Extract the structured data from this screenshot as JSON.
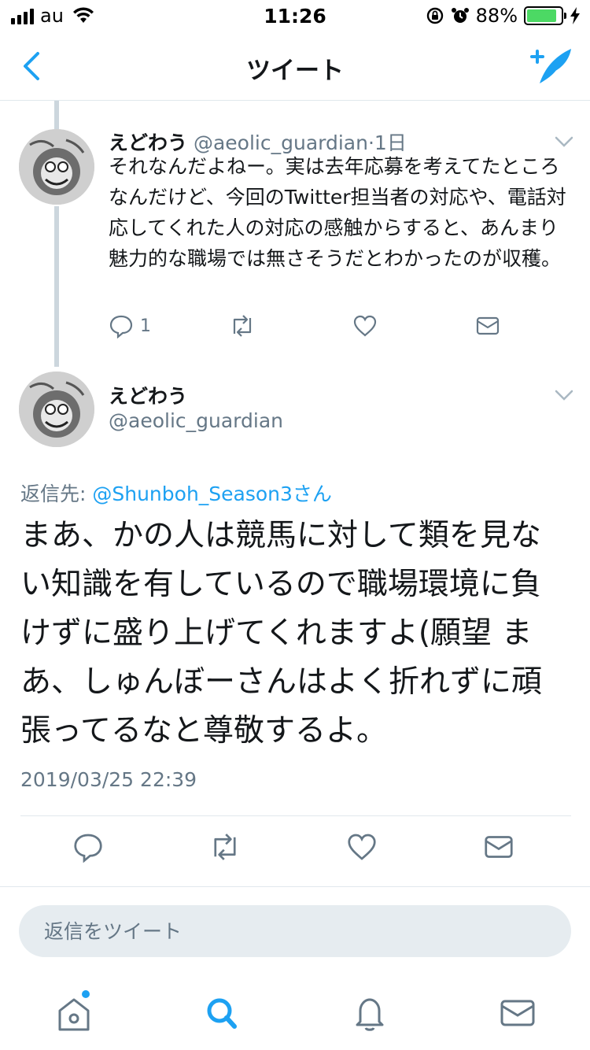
{
  "status_bar": {
    "carrier": "au",
    "time": "11:26",
    "battery_percent": "88%",
    "battery_level": 0.88,
    "battery_color": "#4cd964"
  },
  "nav": {
    "title": "ツイート",
    "back_icon": "chevron-left-icon",
    "compose_icon": "compose-tweet-icon",
    "accent": "#1da1f2"
  },
  "previous_tweet": {
    "name": "えどわう",
    "handle": "@aeolic_guardian",
    "separator": "·",
    "time_ago": "1日",
    "text": "それなんだよねー。実は去年応募を考えてたところなんだけど、今回のTwitter担当者の対応や、電話対応してくれた人の対応の感触からすると、あんまり魅力的な職場では無さそうだとわかったのが収穫。",
    "reply_count": "1",
    "actions": [
      "reply-icon",
      "retweet-icon",
      "like-icon",
      "direct-message-icon"
    ]
  },
  "focused_tweet": {
    "name": "えどわう",
    "handle": "@aeolic_guardian",
    "reply_prefix": "返信先: ",
    "reply_mention": "@Shunboh_Season3さん",
    "text": "まあ、かの人は競馬に対して類を見ない知識を有しているので職場環境に負けずに盛り上げてくれますよ(願望 まあ、しゅんぼーさんはよく折れずに頑張ってるなと尊敬するよ。",
    "timestamp": "2019/03/25 22:39",
    "actions": [
      "reply-icon",
      "retweet-icon",
      "like-icon",
      "direct-message-icon"
    ]
  },
  "reply_composer": {
    "placeholder": "返信をツイート"
  },
  "tab_bar": {
    "tabs": [
      "home-icon",
      "search-icon",
      "notifications-icon",
      "messages-icon"
    ],
    "active_tab": "search-icon"
  }
}
